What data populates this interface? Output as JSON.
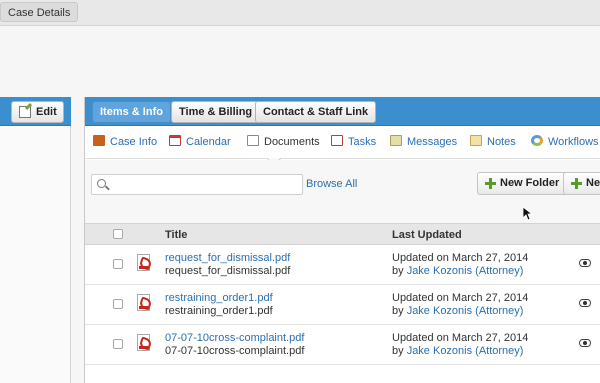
{
  "top_tab": {
    "label": "Case Details"
  },
  "left_panel": {
    "edit_label": "Edit"
  },
  "header_buttons": [
    {
      "label": "Items & Info",
      "active": true
    },
    {
      "label": "Time & Billing",
      "active": false
    },
    {
      "label": "Contact & Staff Link",
      "active": false
    }
  ],
  "subnav": [
    {
      "label": "Case Info",
      "icon": "briefcase-icon",
      "color": "#c8621a"
    },
    {
      "label": "Calendar",
      "icon": "calendar-icon",
      "color": "#c23a3a"
    },
    {
      "label": "Documents",
      "icon": "document-icon",
      "color": "#8a8a8a",
      "current": true
    },
    {
      "label": "Tasks",
      "icon": "tasks-icon",
      "color": "#b0462b"
    },
    {
      "label": "Messages",
      "icon": "messages-icon",
      "color": "#a8a24a"
    },
    {
      "label": "Notes",
      "icon": "notes-icon",
      "color": "#c9a44a"
    },
    {
      "label": "Workflows",
      "icon": "workflows-icon",
      "color": "#5a9ad6"
    }
  ],
  "toolbar": {
    "search_placeholder": "",
    "browse_all": "Browse All",
    "new_folder": "New Folder",
    "new_partial": "Ne"
  },
  "table": {
    "columns": {
      "title": "Title",
      "last_updated": "Last Updated"
    },
    "rows": [
      {
        "link": "request_for_dismissal.pdf",
        "name": "request_for_dismissal.pdf",
        "updated_on": "Updated on March 27, 2014",
        "updated_by_prefix": "by ",
        "updated_by": "Jake Kozonis (Attorney)"
      },
      {
        "link": "restraining_order1.pdf",
        "name": "restraining_order1.pdf",
        "updated_on": "Updated on March 27, 2014",
        "updated_by_prefix": "by ",
        "updated_by": "Jake Kozonis (Attorney)"
      },
      {
        "link": "07-07-10cross-complaint.pdf",
        "name": "07-07-10cross-complaint.pdf",
        "updated_on": "Updated on March 27, 2014",
        "updated_by_prefix": "by ",
        "updated_by": "Jake Kozonis (Attorney)"
      }
    ]
  },
  "colors": {
    "header_blue": "#3b8fcf",
    "link_blue": "#2a6fb3",
    "active_button": "#5fa4dd"
  }
}
